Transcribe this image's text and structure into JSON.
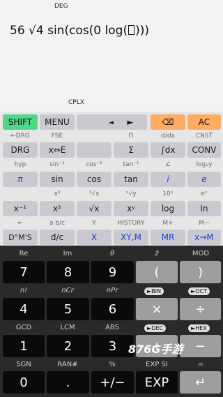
{
  "display": {
    "mode_top": "DEG",
    "expr_prefix": "56 √4 sin(cos(0 log(",
    "expr_suffix": ")))",
    "mode_bottom": "CPLX"
  },
  "row1": {
    "shift": "SHIFT",
    "menu": "MENU",
    "left": "◄",
    "right": "►",
    "back": "⌫",
    "ac": "AC"
  },
  "sub1": [
    "←DRG",
    "FSE",
    "Π",
    "d/dx",
    "CNST"
  ],
  "row2": [
    "DRG",
    "x⇔E",
    "",
    "Σ",
    "∫dx",
    "CONV"
  ],
  "sub2": [
    "hyp",
    "sin⁻¹",
    "cos⁻¹",
    "tan⁻¹",
    "∠",
    "logₓy"
  ],
  "row3": [
    "π",
    "sin",
    "cos",
    "tan",
    "i",
    "e"
  ],
  "sub3": [
    "x³",
    "³√x",
    "ˣ√y",
    "10ˣ",
    "eˣ"
  ],
  "row4": [
    "x⁻¹",
    "x²",
    "√x",
    "xʸ",
    "log",
    "ln"
  ],
  "sub4": [
    "←",
    "a b/c",
    "Y",
    "HISTORY",
    "M+",
    "M−"
  ],
  "row5": [
    "D°M'S",
    "d/c",
    "X",
    "XY,M",
    "MR",
    "x→M"
  ],
  "dsub1": [
    "Re",
    "Im",
    "θ",
    "z̄",
    "MOD"
  ],
  "drow1": [
    "7",
    "8",
    "9",
    "(",
    ")"
  ],
  "dsub2": [
    "n!",
    "nCr",
    "nPr"
  ],
  "pills2": [
    "►BIN",
    "►OCT"
  ],
  "drow2": [
    "4",
    "5",
    "6",
    "×",
    "÷"
  ],
  "dsub3": [
    "GCD",
    "LCM",
    "ABS"
  ],
  "pills3": [
    "►DEC",
    "►HEX"
  ],
  "drow3": [
    "1",
    "2",
    "3",
    "+",
    "−"
  ],
  "dsub4": [
    "SGN",
    "RAN#",
    "%",
    "EXP SI",
    "="
  ],
  "drow4": [
    "0",
    ".",
    "+/−",
    "EXP",
    "↵"
  ],
  "watermark": "876G手游"
}
